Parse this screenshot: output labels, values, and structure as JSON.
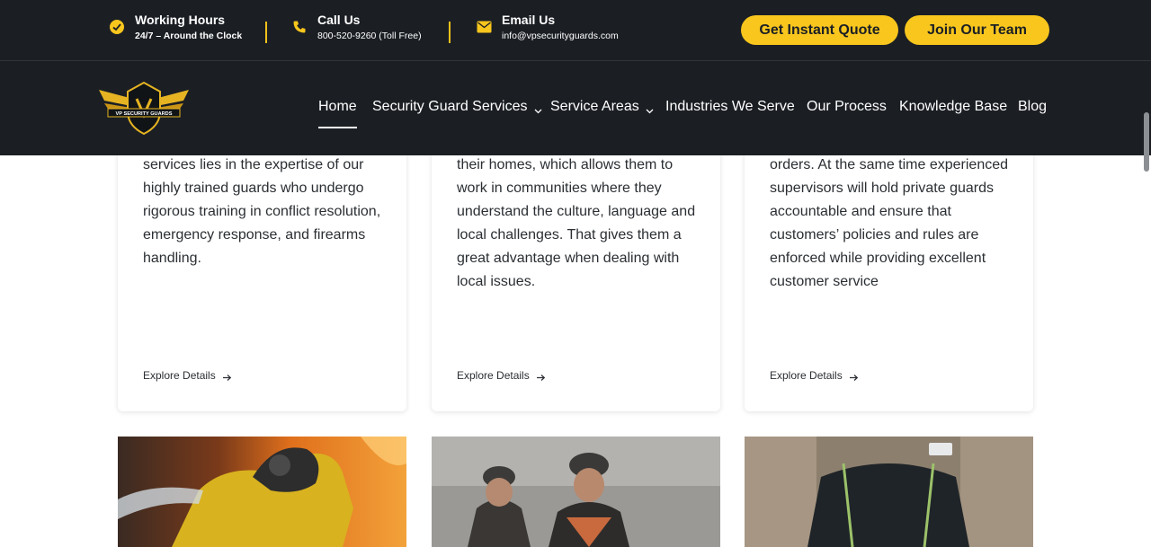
{
  "topbar": {
    "working_hours": {
      "title": "Working Hours",
      "subtitle": "24/7 – Around the Clock"
    },
    "call_us": {
      "title": "Call Us",
      "subtitle": "800-520-9260 (Toll Free)"
    },
    "email_us": {
      "title": "Email Us",
      "subtitle": "info@vpsecurityguards.com"
    },
    "quote_label": "Get Instant Quote",
    "join_label": "Join Our Team"
  },
  "logo": {
    "text": "VP SECURITY GUARDS"
  },
  "nav": {
    "items": [
      {
        "label": "Home",
        "active": true
      },
      {
        "label": "Security Guard Services",
        "dropdown": true
      },
      {
        "label": "Service Areas",
        "dropdown": true
      },
      {
        "label": "Industries We Serve"
      },
      {
        "label": "Our Process"
      },
      {
        "label": "Knowledge Base"
      },
      {
        "label": "Blog"
      }
    ]
  },
  "cards": [
    {
      "body": "services lies in the expertise of our highly trained guards who undergo rigorous training in conflict resolution, emergency response, and firearms handling.",
      "link": "Explore Details"
    },
    {
      "body": "their homes, which allows them to work in communities where they understand the culture, language and local challenges. That gives them a great advantage when dealing with local issues.",
      "link": "Explore Details"
    },
    {
      "body": "orders. At the same time experienced supervisors will hold private guards accountable and ensure that customers’ policies and rules are enforced while providing excellent customer service",
      "link": "Explore Details"
    }
  ],
  "colors": {
    "accent": "#f8c61d",
    "dark": "#1b1f24",
    "text": "#2b2f33"
  }
}
